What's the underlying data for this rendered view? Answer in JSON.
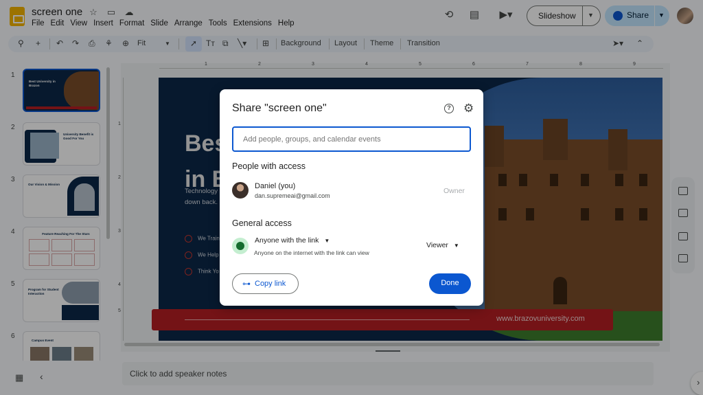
{
  "app": {
    "doc_title": "screen one",
    "menu": [
      "File",
      "Edit",
      "View",
      "Insert",
      "Format",
      "Slide",
      "Arrange",
      "Tools",
      "Extensions",
      "Help"
    ],
    "slideshow_label": "Slideshow",
    "share_label": "Share",
    "brand_color": "#f4b400",
    "accent_color": "#0b57d0"
  },
  "toolbar": {
    "zoom": "Fit",
    "background_label": "Background",
    "layout_label": "Layout",
    "theme_label": "Theme",
    "transition_label": "Transition"
  },
  "filmstrip": {
    "slides": [
      {
        "num": "1",
        "title": "Best University in Brazon"
      },
      {
        "num": "2",
        "title": "University Benefit is Good For You"
      },
      {
        "num": "3",
        "title": "Our Vision & Mission"
      },
      {
        "num": "4",
        "title": "Feature Reaching For The Stars"
      },
      {
        "num": "5",
        "title": "Program for Student Interaction"
      },
      {
        "num": "6",
        "title": "Campus Event"
      }
    ]
  },
  "ruler": {
    "h_ticks": [
      "1",
      "2",
      "3",
      "4",
      "5",
      "6",
      "7",
      "8",
      "9"
    ],
    "v_ticks": [
      "1",
      "2",
      "3",
      "4",
      "5"
    ]
  },
  "slide": {
    "title_line1": "Bes",
    "title_line2": "in B",
    "body": "Technology about havin down back.",
    "bullets": [
      "We Train",
      "We Help",
      "Think Yo"
    ],
    "url": "www.brazovuniversity.com"
  },
  "notes": {
    "placeholder": "Click to add speaker notes"
  },
  "share_dialog": {
    "title": "Share \"screen one\"",
    "input_placeholder": "Add people, groups, and calendar events",
    "people_heading": "People with access",
    "person": {
      "name": "Daniel (you)",
      "email": "dan.supremeai@gmail.com",
      "role": "Owner"
    },
    "general_heading": "General access",
    "general_access": {
      "scope": "Anyone with the link",
      "description": "Anyone on the internet with the link can view",
      "role": "Viewer"
    },
    "copy_link_label": "Copy link",
    "done_label": "Done"
  }
}
